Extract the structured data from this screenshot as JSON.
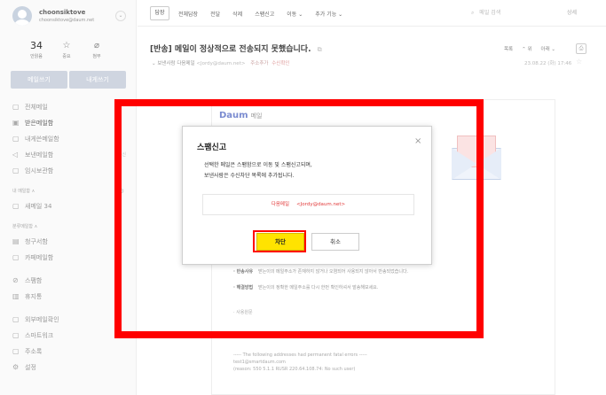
{
  "profile": {
    "name": "choonsiktove",
    "email": "choonsiktove@daum.net",
    "toggle": "⌄"
  },
  "stats": [
    {
      "value": "34",
      "icon": "",
      "label": "안읽음"
    },
    {
      "value": "",
      "icon": "☆",
      "label": "중요"
    },
    {
      "value": "",
      "icon": "⌀",
      "label": "첨부"
    }
  ],
  "compose": {
    "write": "메일쓰기",
    "self": "내게쓰기"
  },
  "sidebar": {
    "items": [
      {
        "icon": "▢",
        "label": "전체메일",
        "badge": ""
      },
      {
        "icon": "▣",
        "label": "받은메일함",
        "badge": ""
      },
      {
        "icon": "▢",
        "label": "내게쓴메일함",
        "badge": ""
      },
      {
        "icon": "◁",
        "label": "보낸메일함",
        "badge": "수신"
      },
      {
        "icon": "▢",
        "label": "임시보관함",
        "badge": ""
      }
    ],
    "section_my": "내 메일함 ∧",
    "my_items": [
      {
        "icon": "▢",
        "label": "새메일 34",
        "badge": ""
      }
    ],
    "section_category": "분류메일함 ∧",
    "category_items": [
      {
        "icon": "▤",
        "label": "청구서함",
        "badge": ""
      },
      {
        "icon": "▢",
        "label": "카페메일함",
        "badge": ""
      }
    ],
    "bottom_items": [
      {
        "icon": "⊘",
        "label": "스팸함",
        "badge": ""
      },
      {
        "icon": "▥",
        "label": "휴지통",
        "badge": ""
      }
    ],
    "extra_items": [
      {
        "icon": "▢",
        "label": "외부메일확인",
        "badge": ""
      },
      {
        "icon": "▢",
        "label": "스마트워크",
        "badge": ""
      },
      {
        "icon": "▢",
        "label": "주소록",
        "badge": ""
      },
      {
        "icon": "⚙",
        "label": "설정",
        "badge": ""
      }
    ]
  },
  "toolbar": {
    "reply": "답장",
    "items": [
      "전체답장",
      "전달",
      "삭제",
      "스팸신고",
      "이동 ⌄",
      "추가 기능 ⌄"
    ],
    "search_placeholder": "메일 검색",
    "detail": "상세"
  },
  "mail": {
    "subject": "[반송] 메일이 정상적으로 전송되지 못했습니다.",
    "copy": "⧉",
    "sender_label": "보낸사람",
    "sender_name": "다음메일",
    "sender_addr": "<Jordy@daum.net>",
    "add_address": "주소추가",
    "unverified": "수신확인",
    "head_actions": [
      "목록",
      "⌃ 위",
      "아래 ⌄"
    ],
    "date": "23.08.22 (화) 17:46"
  },
  "body": {
    "logo": "Daum",
    "logo_suffix": "메일",
    "rows": [
      {
        "key": "· 반송사유",
        "value": "받는이의 메일주소가 존재하지 않거나 오염되어 사용되지 않아서 반송되었습니다."
      },
      {
        "key": "· 해결방법",
        "value": "받는이의 정확한 메일주소를 다시 한번 확인하셔서 발송해보세요."
      }
    ],
    "origin": "· 사용원문",
    "lines": [
      "----- The following addresses had permanent fatal errors -----",
      "test1@smartdaum.com",
      "(reason: 550 5.1.1 RUSR 220.64.108.74: No such user)"
    ]
  },
  "modal": {
    "title": "스팸신고",
    "close": "×",
    "message_1": "선택한 메일은 스팸함으로 이동 및 스팸신고되며,",
    "message_2": "보낸사람은 수신차단 목록에 추가됩니다.",
    "blocked_name": "다음메일",
    "blocked_addr": "<Jordy@daum.net>",
    "confirm": "차단",
    "cancel": "취소"
  },
  "colors": {
    "highlight": "#ff0000",
    "confirm_bg": "#ffe300",
    "blocked_text": "#e23b3b"
  }
}
